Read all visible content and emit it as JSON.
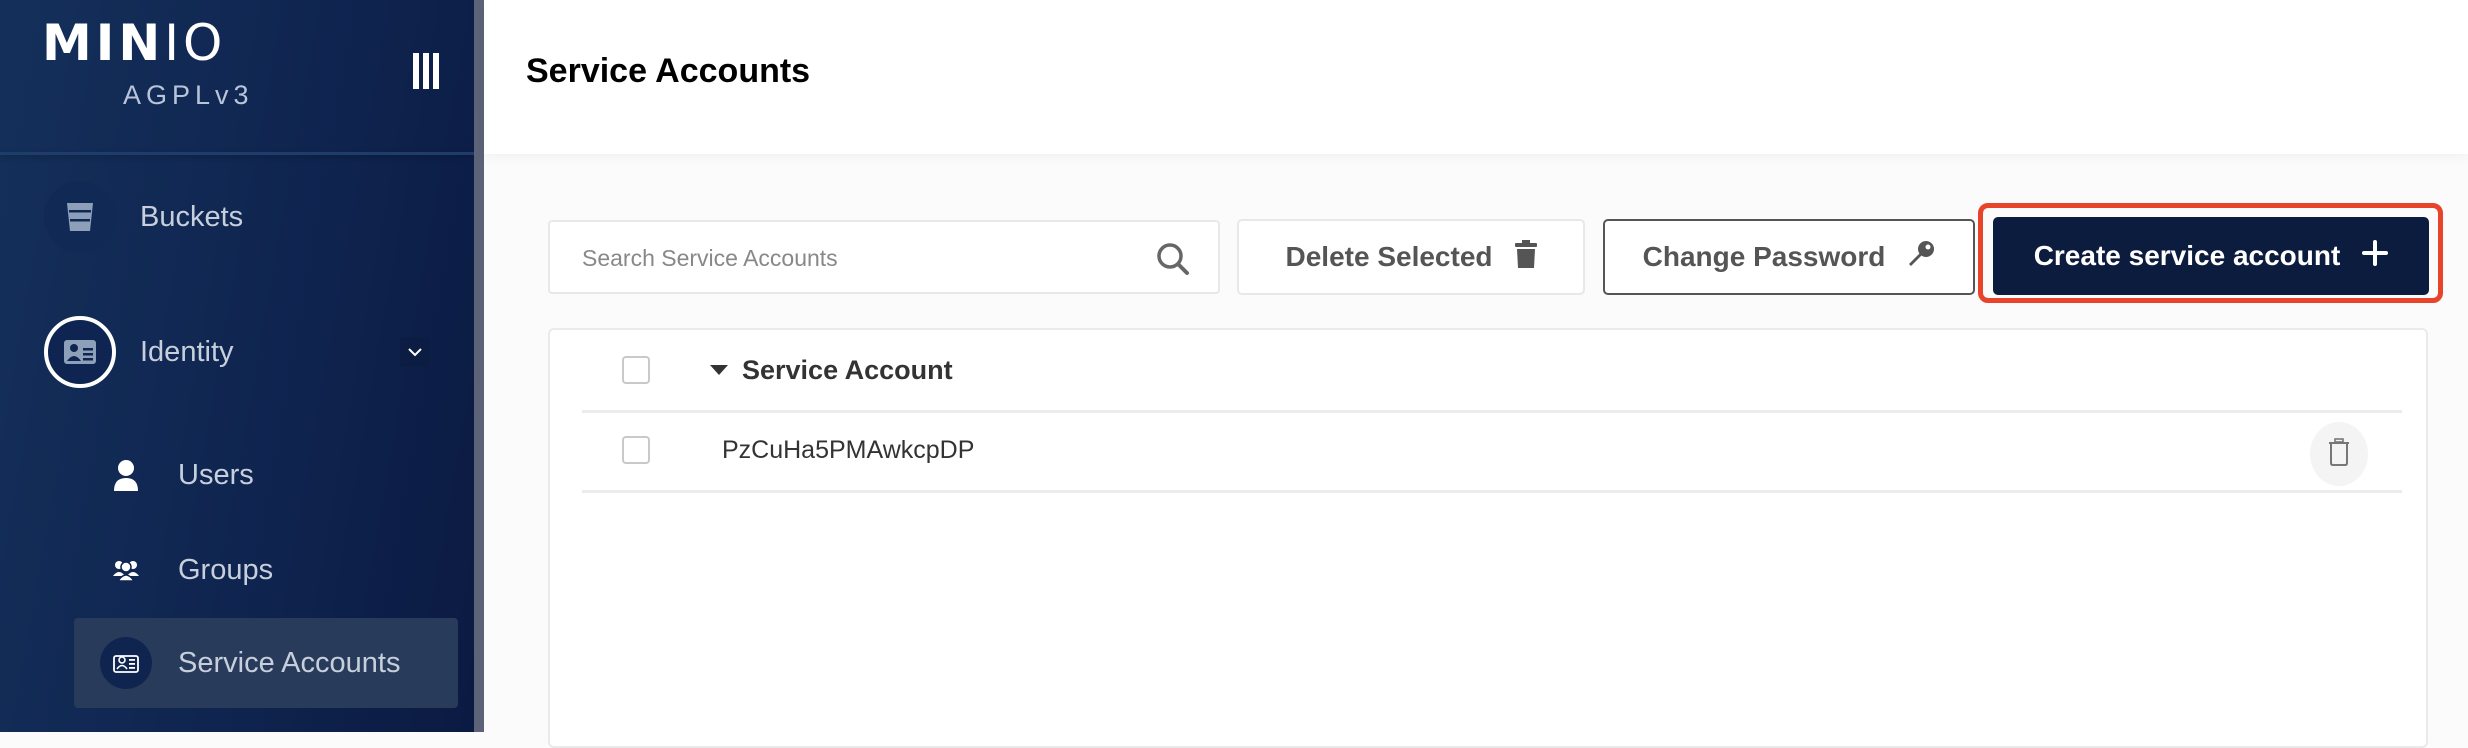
{
  "sidebar": {
    "logo_bold": "MIN",
    "logo_thin": "IO",
    "license": "AGPLv3",
    "menu_icon": "hamburger-icon",
    "items": [
      {
        "label": "Buckets",
        "icon": "bucket-icon"
      },
      {
        "label": "Identity",
        "icon": "id-card-icon",
        "expanded": true,
        "children": [
          {
            "label": "Users",
            "icon": "user-icon"
          },
          {
            "label": "Groups",
            "icon": "users-group-icon"
          },
          {
            "label": "Service Accounts",
            "icon": "service-account-icon",
            "active": true
          }
        ]
      }
    ]
  },
  "header": {
    "title": "Service Accounts"
  },
  "toolbar": {
    "search_placeholder": "Search Service Accounts",
    "search_value": "",
    "delete_selected_label": "Delete Selected",
    "change_password_label": "Change Password",
    "create_label": "Create service account"
  },
  "table": {
    "columns": [
      "Service Account"
    ],
    "sort_direction": "descending",
    "rows": [
      {
        "service_account": "PzCuHa5PMAwkcpDP"
      }
    ]
  },
  "colors": {
    "sidebar_bg": "#0f2550",
    "primary_button": "#0c1c3e",
    "highlight_outline": "#e8442c"
  }
}
